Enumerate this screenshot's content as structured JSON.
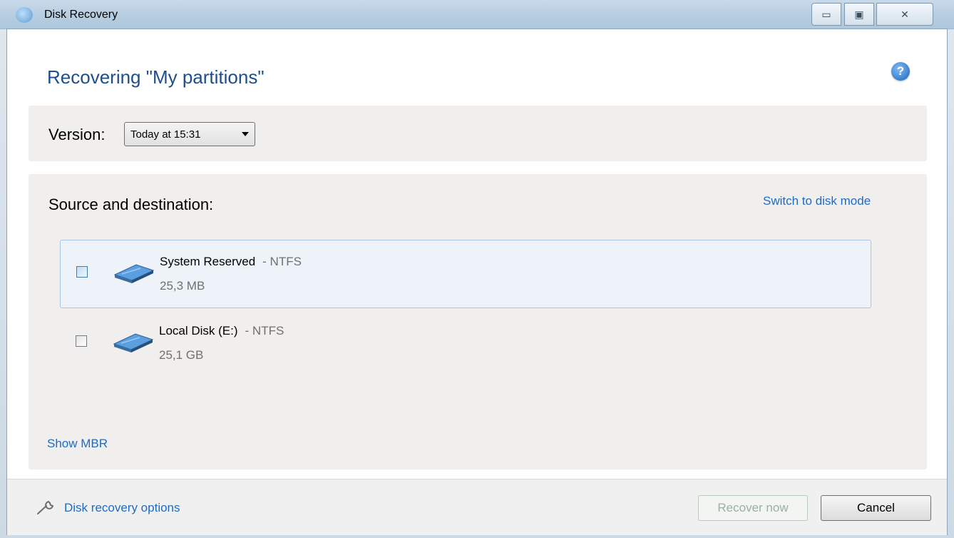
{
  "window": {
    "title": "Disk Recovery"
  },
  "header": {
    "title": "Recovering \"My partitions\""
  },
  "version": {
    "label": "Version:",
    "selected": "Today at 15:31"
  },
  "source": {
    "label": "Source and destination:",
    "switch_link": "Switch to disk mode",
    "partitions": [
      {
        "name": "System Reserved",
        "fs": "- NTFS",
        "size": "25,3 MB",
        "checked": false,
        "highlighted": true
      },
      {
        "name": "Local Disk (E:)",
        "fs": "- NTFS",
        "size": "25,1 GB",
        "checked": false,
        "highlighted": false
      }
    ],
    "show_mbr": "Show MBR"
  },
  "footer": {
    "options_link": "Disk recovery options",
    "recover_label": "Recover now",
    "cancel_label": "Cancel"
  },
  "colors": {
    "link": "#1f6bc1",
    "heading": "#1e4e8c"
  }
}
